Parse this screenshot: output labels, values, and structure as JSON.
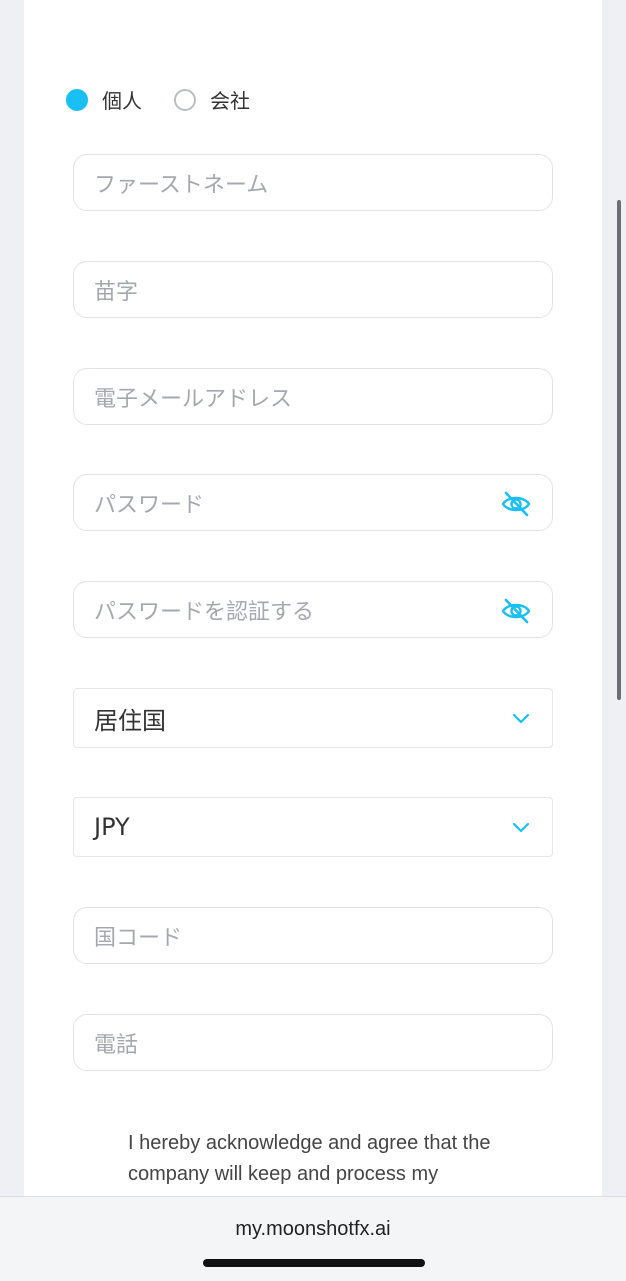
{
  "account_type": {
    "options": [
      {
        "label": "個人",
        "selected": true
      },
      {
        "label": "会社",
        "selected": false
      }
    ]
  },
  "fields": {
    "first_name": {
      "placeholder": "ファーストネーム"
    },
    "last_name": {
      "placeholder": "苗字"
    },
    "email": {
      "placeholder": "電子メールアドレス"
    },
    "password": {
      "placeholder": "パスワード"
    },
    "confirm_password": {
      "placeholder": "パスワードを認証する"
    },
    "country": {
      "value": "居住国"
    },
    "currency": {
      "value": "JPY"
    },
    "country_code": {
      "placeholder": "国コード"
    },
    "phone": {
      "placeholder": "電話"
    }
  },
  "agreement": {
    "text": "I hereby acknowledge and agree that the company will keep and process my"
  },
  "browser": {
    "url": "my.moonshotfx.ai"
  },
  "colors": {
    "accent": "#19bff5",
    "border": "#dfe3e8",
    "placeholder": "#a4a8ae"
  },
  "icons": {
    "password_toggle": "eye-off-icon",
    "select_arrow": "chevron-down-icon"
  }
}
